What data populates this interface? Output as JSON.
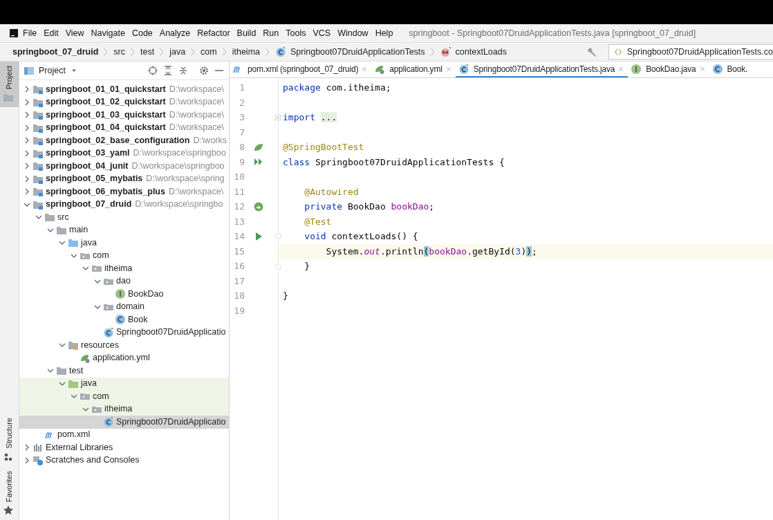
{
  "window": {
    "title": "springboot - Springboot07DruidApplicationTests.java [springboot_07_druid]"
  },
  "menu": [
    "File",
    "Edit",
    "View",
    "Navigate",
    "Code",
    "Analyze",
    "Refactor",
    "Build",
    "Run",
    "Tools",
    "VCS",
    "Window",
    "Help"
  ],
  "breadcrumbs": [
    {
      "label": "springboot_07_druid",
      "kind": "module"
    },
    {
      "label": "src",
      "kind": "folder"
    },
    {
      "label": "test",
      "kind": "folder"
    },
    {
      "label": "java",
      "kind": "folder"
    },
    {
      "label": "com",
      "kind": "folder"
    },
    {
      "label": "itheima",
      "kind": "folder"
    },
    {
      "label": "Springboot07DruidApplicationTests",
      "kind": "class"
    },
    {
      "label": "contextLoads",
      "kind": "method"
    }
  ],
  "run_config": "Springboot07DruidApplicationTests.co",
  "side_tabs": [
    {
      "label": "Project",
      "selected": true,
      "kind": "folder"
    },
    {
      "label": "Structure",
      "selected": false,
      "kind": "structure"
    },
    {
      "label": "Favorites",
      "selected": false,
      "kind": "star"
    }
  ],
  "project": {
    "title": "Project",
    "tree": [
      {
        "label": "springboot_01_01_quickstart",
        "path": "D:\\workspace\\",
        "kind": "module",
        "expanded": false
      },
      {
        "label": "springboot_01_02_quickstart",
        "path": "D:\\workspace\\",
        "kind": "module",
        "expanded": false
      },
      {
        "label": "springboot_01_03_quickstart",
        "path": "D:\\workspace\\",
        "kind": "module",
        "expanded": false
      },
      {
        "label": "springboot_01_04_quickstart",
        "path": "D:\\workspace\\",
        "kind": "module",
        "expanded": false
      },
      {
        "label": "springboot_02_base_configuration",
        "path": "D:\\works",
        "kind": "module",
        "expanded": false
      },
      {
        "label": "springboot_03_yaml",
        "path": "D:\\workspace\\springboo",
        "kind": "module",
        "expanded": false
      },
      {
        "label": "springboot_04_junit",
        "path": "D:\\workspace\\springboo",
        "kind": "module",
        "expanded": false
      },
      {
        "label": "springboot_05_mybatis",
        "path": "D:\\workspace\\spring",
        "kind": "module",
        "expanded": false
      },
      {
        "label": "springboot_06_mybatis_plus",
        "path": "D:\\workspace\\",
        "kind": "module",
        "expanded": false
      },
      {
        "label": "springboot_07_druid",
        "path": "D:\\workspace\\springbo",
        "kind": "module",
        "expanded": true,
        "children": [
          {
            "label": "src",
            "kind": "folder",
            "expanded": true,
            "children": [
              {
                "label": "main",
                "kind": "folder",
                "expanded": true,
                "children": [
                  {
                    "label": "java",
                    "kind": "source",
                    "expanded": true,
                    "children": [
                      {
                        "label": "com",
                        "kind": "package",
                        "expanded": true,
                        "children": [
                          {
                            "label": "itheima",
                            "kind": "package",
                            "expanded": true,
                            "children": [
                              {
                                "label": "dao",
                                "kind": "package",
                                "expanded": true,
                                "children": [
                                  {
                                    "label": "BookDao",
                                    "kind": "interface"
                                  }
                                ]
                              },
                              {
                                "label": "domain",
                                "kind": "package",
                                "expanded": true,
                                "children": [
                                  {
                                    "label": "Book",
                                    "kind": "class"
                                  }
                                ]
                              },
                              {
                                "label": "Springboot07DruidApplicatio",
                                "kind": "spring-class"
                              }
                            ]
                          }
                        ]
                      }
                    ]
                  },
                  {
                    "label": "resources",
                    "kind": "resources",
                    "expanded": true,
                    "children": [
                      {
                        "label": "application.yml",
                        "kind": "yml"
                      }
                    ]
                  }
                ]
              },
              {
                "label": "test",
                "kind": "folder",
                "expanded": true,
                "children": [
                  {
                    "label": "java",
                    "kind": "test-source",
                    "expanded": true,
                    "highlighted": true,
                    "children": [
                      {
                        "label": "com",
                        "kind": "package",
                        "expanded": true,
                        "highlighted": true,
                        "children": [
                          {
                            "label": "itheima",
                            "kind": "package",
                            "expanded": true,
                            "highlighted": true,
                            "children": [
                              {
                                "label": "Springboot07DruidApplicatio",
                                "kind": "spring-class",
                                "selected": true
                              }
                            ]
                          }
                        ]
                      }
                    ]
                  }
                ]
              }
            ]
          },
          {
            "label": "pom.xml",
            "kind": "maven"
          }
        ]
      },
      {
        "label": "External Libraries",
        "kind": "libraries",
        "expanded": false
      },
      {
        "label": "Scratches and Consoles",
        "kind": "scratches",
        "expanded": false
      }
    ]
  },
  "editor_tabs": [
    {
      "label": "pom.xml (springboot_07_druid)",
      "kind": "maven",
      "selected": false,
      "closable": true
    },
    {
      "label": "application.yml",
      "kind": "yml",
      "selected": false,
      "closable": true
    },
    {
      "label": "Springboot07DruidApplicationTests.java",
      "kind": "spring-class",
      "selected": true,
      "closable": true
    },
    {
      "label": "BookDao.java",
      "kind": "interface",
      "selected": false,
      "closable": true
    },
    {
      "label": "Book.",
      "kind": "class",
      "selected": false,
      "closable": false
    }
  ],
  "code": [
    {
      "number": "1",
      "tokens": [
        {
          "text": "package ",
          "kind": "keyword"
        },
        {
          "text": "com.itheima;",
          "kind": "plain"
        }
      ]
    },
    {
      "number": "2"
    },
    {
      "number": "3",
      "fold": {
        "kind": "plus"
      },
      "tokens": [
        {
          "text": "import ",
          "kind": "keyword"
        },
        {
          "text": "...",
          "kind": "folded"
        }
      ]
    },
    {
      "number": "7"
    },
    {
      "number": "8",
      "gutter": {
        "kind": "spring"
      },
      "tokens": [
        {
          "text": "@SpringBootTest",
          "kind": "annotation"
        }
      ]
    },
    {
      "number": "9",
      "gutter": {
        "kind": "run-all"
      },
      "tokens": [
        {
          "text": "class ",
          "kind": "keyword"
        },
        {
          "text": "Springboot07DruidApplicationTests {",
          "kind": "plain"
        }
      ]
    },
    {
      "number": "10"
    },
    {
      "number": "11",
      "tokens": [
        {
          "text": "    @Autowired",
          "kind": "annotation"
        }
      ]
    },
    {
      "number": "12",
      "gutter": {
        "kind": "bean"
      },
      "tokens": [
        {
          "text": "    private ",
          "kind": "keyword"
        },
        {
          "text": "BookDao ",
          "kind": "plain"
        },
        {
          "text": "bookDao",
          "kind": "field"
        },
        {
          "text": ";",
          "kind": "plain"
        }
      ]
    },
    {
      "number": "13",
      "tokens": [
        {
          "text": "    @Test",
          "kind": "annotation"
        }
      ]
    },
    {
      "number": "14",
      "gutter": {
        "kind": "run"
      },
      "fold": {
        "kind": "open"
      },
      "tokens": [
        {
          "text": "    void ",
          "kind": "keyword"
        },
        {
          "text": "contextLoads() {",
          "kind": "plain"
        }
      ]
    },
    {
      "number": "15",
      "current": true,
      "tokens": [
        {
          "text": "        System.",
          "kind": "plain"
        },
        {
          "text": "out",
          "kind": "static"
        },
        {
          "text": ".println",
          "kind": "plain"
        },
        {
          "text": "(",
          "kind": "match"
        },
        {
          "text": "bookDao",
          "kind": "field"
        },
        {
          "text": ".getById(",
          "kind": "plain"
        },
        {
          "text": "3",
          "kind": "number"
        },
        {
          "text": ")",
          "kind": "plain"
        },
        {
          "text": ")",
          "kind": "match"
        },
        {
          "text": ";",
          "kind": "plain"
        }
      ]
    },
    {
      "number": "16",
      "fold": {
        "kind": "close"
      },
      "tokens": [
        {
          "text": "    }",
          "kind": "plain"
        }
      ]
    },
    {
      "number": "17"
    },
    {
      "number": "18",
      "tokens": [
        {
          "text": "}",
          "kind": "plain"
        }
      ]
    },
    {
      "number": "19"
    }
  ]
}
